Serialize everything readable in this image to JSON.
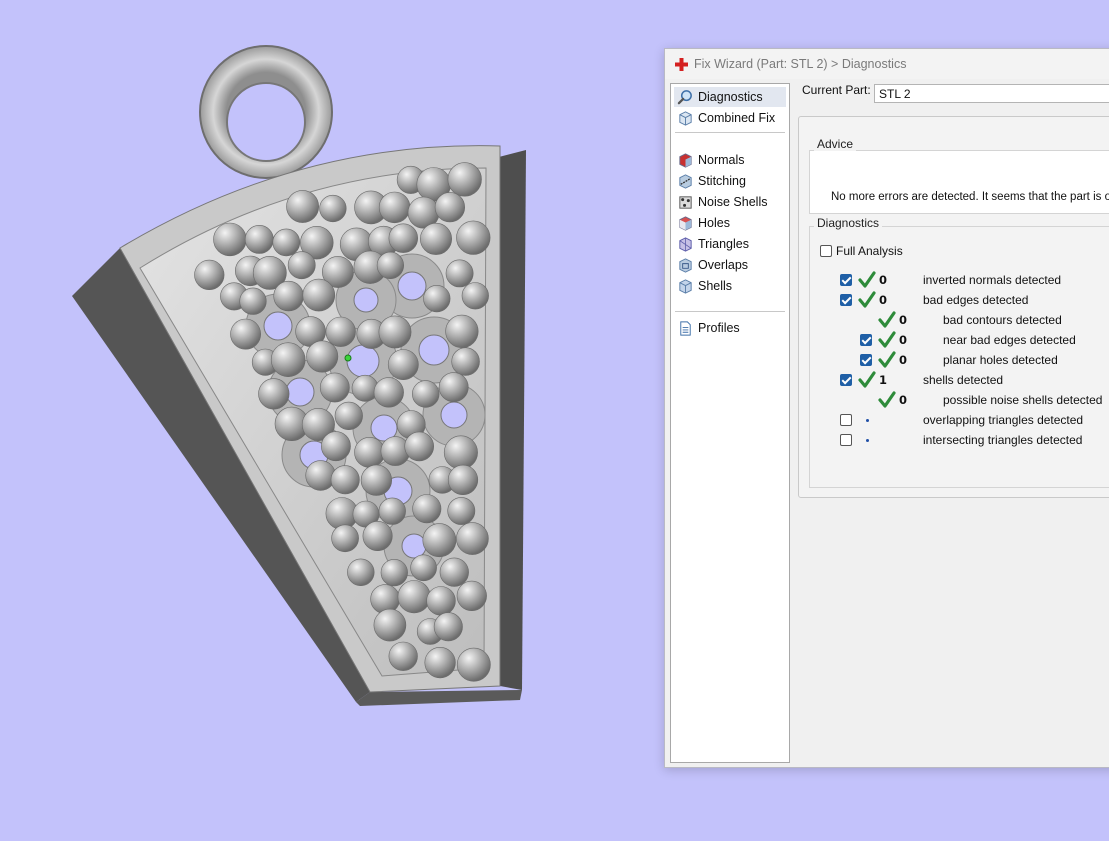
{
  "app": {
    "window_title": "Fix Wizard (Part: STL 2) > Diagnostics",
    "accent_color": "#1f5fa6",
    "check_color": "#2e8b3a",
    "viewport_background": "#c3c2fb"
  },
  "nav": {
    "items": [
      {
        "label": "Diagnostics",
        "icon": "magnifier-icon"
      },
      {
        "label": "Combined Fix",
        "icon": "cube-icon"
      },
      {
        "label": "Normals",
        "icon": "normals-cube-icon"
      },
      {
        "label": "Stitching",
        "icon": "stitching-icon"
      },
      {
        "label": "Noise Shells",
        "icon": "noise-shells-icon"
      },
      {
        "label": "Holes",
        "icon": "holes-cube-icon"
      },
      {
        "label": "Triangles",
        "icon": "triangles-cube-icon"
      },
      {
        "label": "Overlaps",
        "icon": "overlaps-cube-icon"
      },
      {
        "label": "Shells",
        "icon": "shells-cube-icon"
      },
      {
        "label": "Profiles",
        "icon": "document-icon"
      }
    ],
    "selected": "Diagnostics"
  },
  "current_part": {
    "label": "Current Part:",
    "value": "STL 2"
  },
  "advice": {
    "title": "Advice",
    "text": "No more errors are detected. It seems that the part is ok. No"
  },
  "diagnostics": {
    "title": "Diagnostics",
    "full_analysis_label": "Full Analysis",
    "full_analysis_checked": false,
    "rows": [
      {
        "checkbox": true,
        "checked": true,
        "status": "ok",
        "count": "0",
        "label": "inverted normals detected",
        "indent": 0
      },
      {
        "checkbox": true,
        "checked": true,
        "status": "ok",
        "count": "0",
        "label": "bad edges detected",
        "indent": 0
      },
      {
        "checkbox": false,
        "checked": false,
        "status": "ok",
        "count": "0",
        "label": "bad contours detected",
        "indent": 1
      },
      {
        "checkbox": true,
        "checked": true,
        "status": "ok",
        "count": "0",
        "label": "near bad edges detected",
        "indent": 1
      },
      {
        "checkbox": true,
        "checked": true,
        "status": "ok",
        "count": "0",
        "label": "planar holes detected",
        "indent": 1
      },
      {
        "checkbox": true,
        "checked": true,
        "status": "ok",
        "count": "1",
        "label": "shells detected",
        "indent": 0
      },
      {
        "checkbox": false,
        "checked": false,
        "status": "ok",
        "count": "0",
        "label": "possible noise shells detected",
        "indent": 1
      },
      {
        "checkbox": true,
        "checked": false,
        "status": "none",
        "count": "",
        "label": "overlapping triangles detected",
        "indent": 0
      },
      {
        "checkbox": true,
        "checked": false,
        "status": "none",
        "count": "",
        "label": "intersecting triangles detected",
        "indent": 0
      }
    ]
  }
}
